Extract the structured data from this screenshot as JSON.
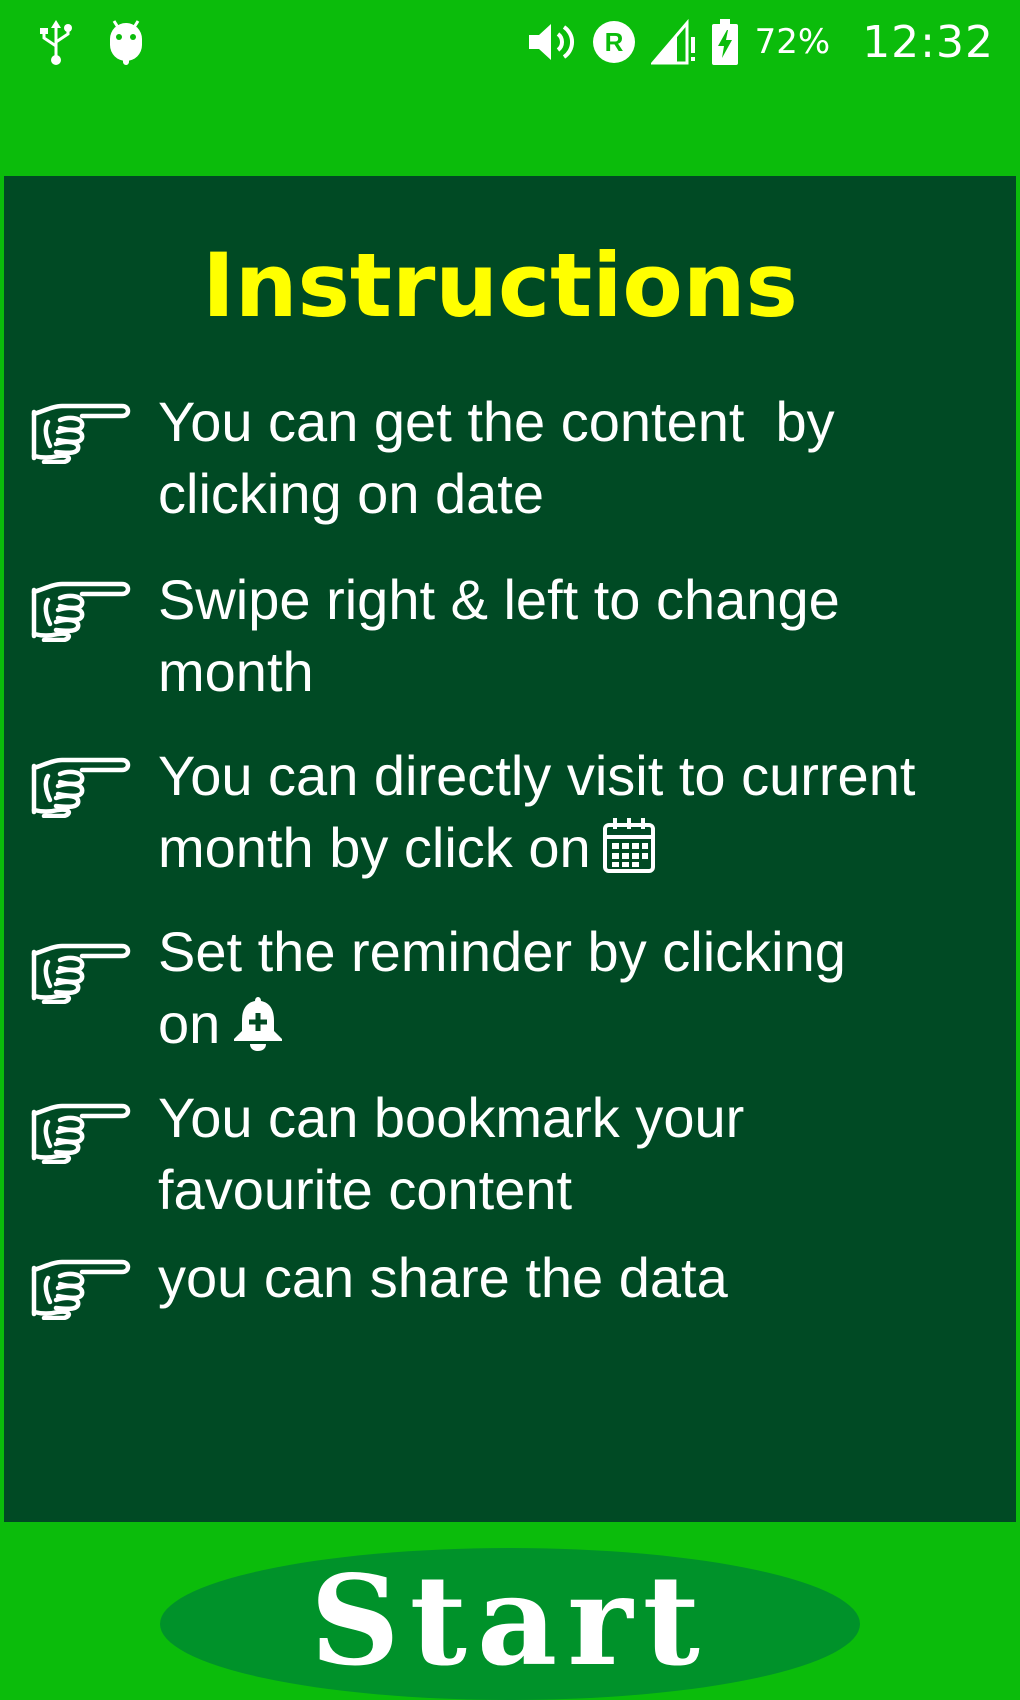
{
  "status_bar": {
    "icons_left": [
      "usb-icon",
      "android-icon"
    ],
    "icons_right": [
      "volume-icon",
      "roaming-icon",
      "signal-icon",
      "battery-charging-icon"
    ],
    "battery_percent": "72%",
    "time": "12:32"
  },
  "panel": {
    "title": "Instructions",
    "items": [
      {
        "text": "You can get the content  by\nclicking on date",
        "icon": "pointing-hand-icon"
      },
      {
        "text": "Swipe right & left to change\nmonth",
        "icon": "pointing-hand-icon"
      },
      {
        "text": "You can directly visit to current\nmonth by click on",
        "icon": "pointing-hand-icon",
        "inline_icon": "calendar-icon"
      },
      {
        "text": "Set the reminder by clicking\non",
        "icon": "pointing-hand-icon",
        "inline_icon": "add-alarm-bell-icon"
      },
      {
        "text": "You can bookmark your\nfavourite content",
        "icon": "pointing-hand-icon"
      },
      {
        "text": "you can share the data",
        "icon": "pointing-hand-icon"
      }
    ]
  },
  "start_button": {
    "label": "Start"
  },
  "colors": {
    "background": "#0bbc0b",
    "panel": "#004a24",
    "title": "#ffff00",
    "text": "#ffffff",
    "button": "#00922a"
  }
}
